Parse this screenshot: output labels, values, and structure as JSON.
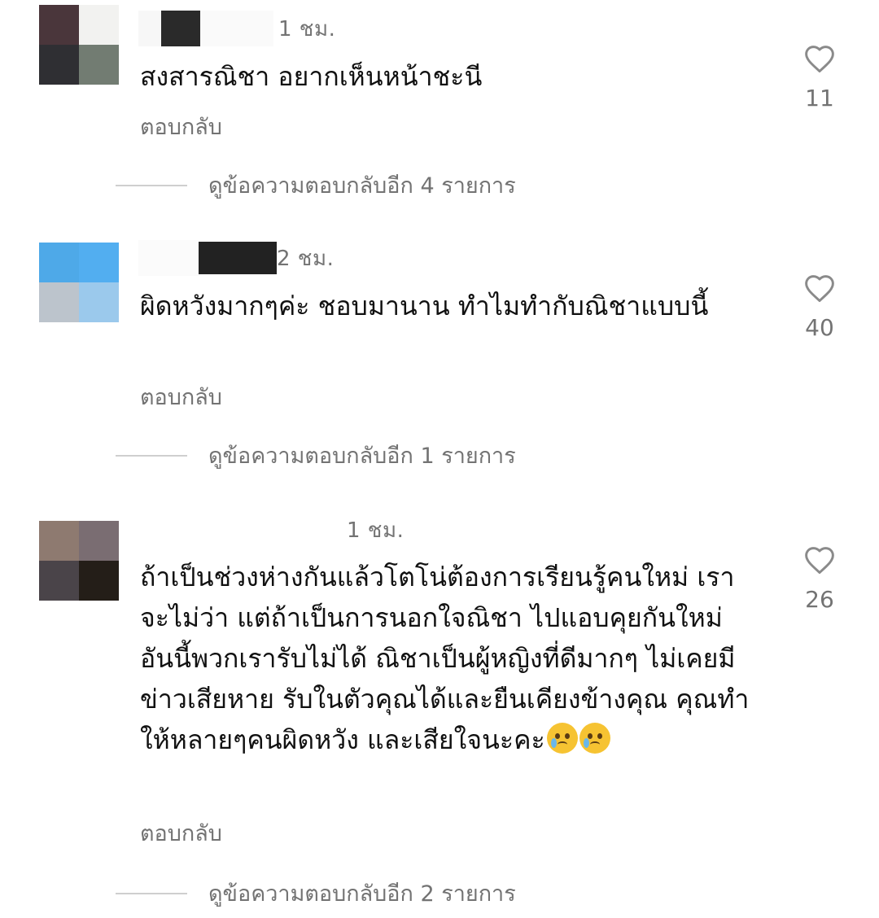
{
  "comments": [
    {
      "time": "1 ชม.",
      "text": "สงสารณิชา อยากเห็นหน้าชะนี",
      "reply_label": "ตอบกลับ",
      "likes": "11",
      "more_replies": "ดูข้อความตอบกลับอีก 4 รายการ",
      "avatar_colors": [
        "#4a363b",
        "#f2f2f0",
        "#2f2f33",
        "#727c72"
      ],
      "username_redact_color": "#2a2a2a"
    },
    {
      "time": "2 ชม.",
      "text": "ผิดหวังมากๆค่ะ ชอบมานาน ทำไมทำกับณิชาแบบนี้",
      "reply_label": "ตอบกลับ",
      "likes": "40",
      "more_replies": "ดูข้อความตอบกลับอีก 1 รายการ",
      "avatar_colors": [
        "#4ea9e8",
        "#52aef0",
        "#bcc4cc",
        "#9bc9ec"
      ],
      "username_redact_color": "#222222"
    },
    {
      "time": "1 ชม.",
      "text": "ถ้าเป็นช่วงห่างกันแล้วโตโน่ต้องการเรียนรู้คนใหม่ เราจะไม่ว่า แต่ถ้าเป็นการนอกใจณิชา ไปแอบคุยกันใหม่ อันนี้พวกเรารับไม่ได้ ณิชาเป็นผู้หญิงที่ดีมากๆ ไม่เคยมีข่าวเสียหาย รับในตัวคุณได้และยืนเคียงข้างคุณ คุณทำให้หลายๆคนผิดหวัง และเสียใจนะคะ",
      "emoji": "crying-face-icon",
      "reply_label": "ตอบกลับ",
      "likes": "26",
      "more_replies": "ดูข้อความตอบกลับอีก 2 รายการ",
      "avatar_colors": [
        "#8e7a70",
        "#7a6d72",
        "#4a4449",
        "#241e18"
      ],
      "username_redact_color": "#ffffff"
    }
  ],
  "icons": {
    "like": "heart-outline-icon"
  },
  "colors": {
    "secondary_text": "#737373",
    "primary_text": "#111111",
    "divider": "#cfcfcf",
    "background": "#ffffff"
  }
}
